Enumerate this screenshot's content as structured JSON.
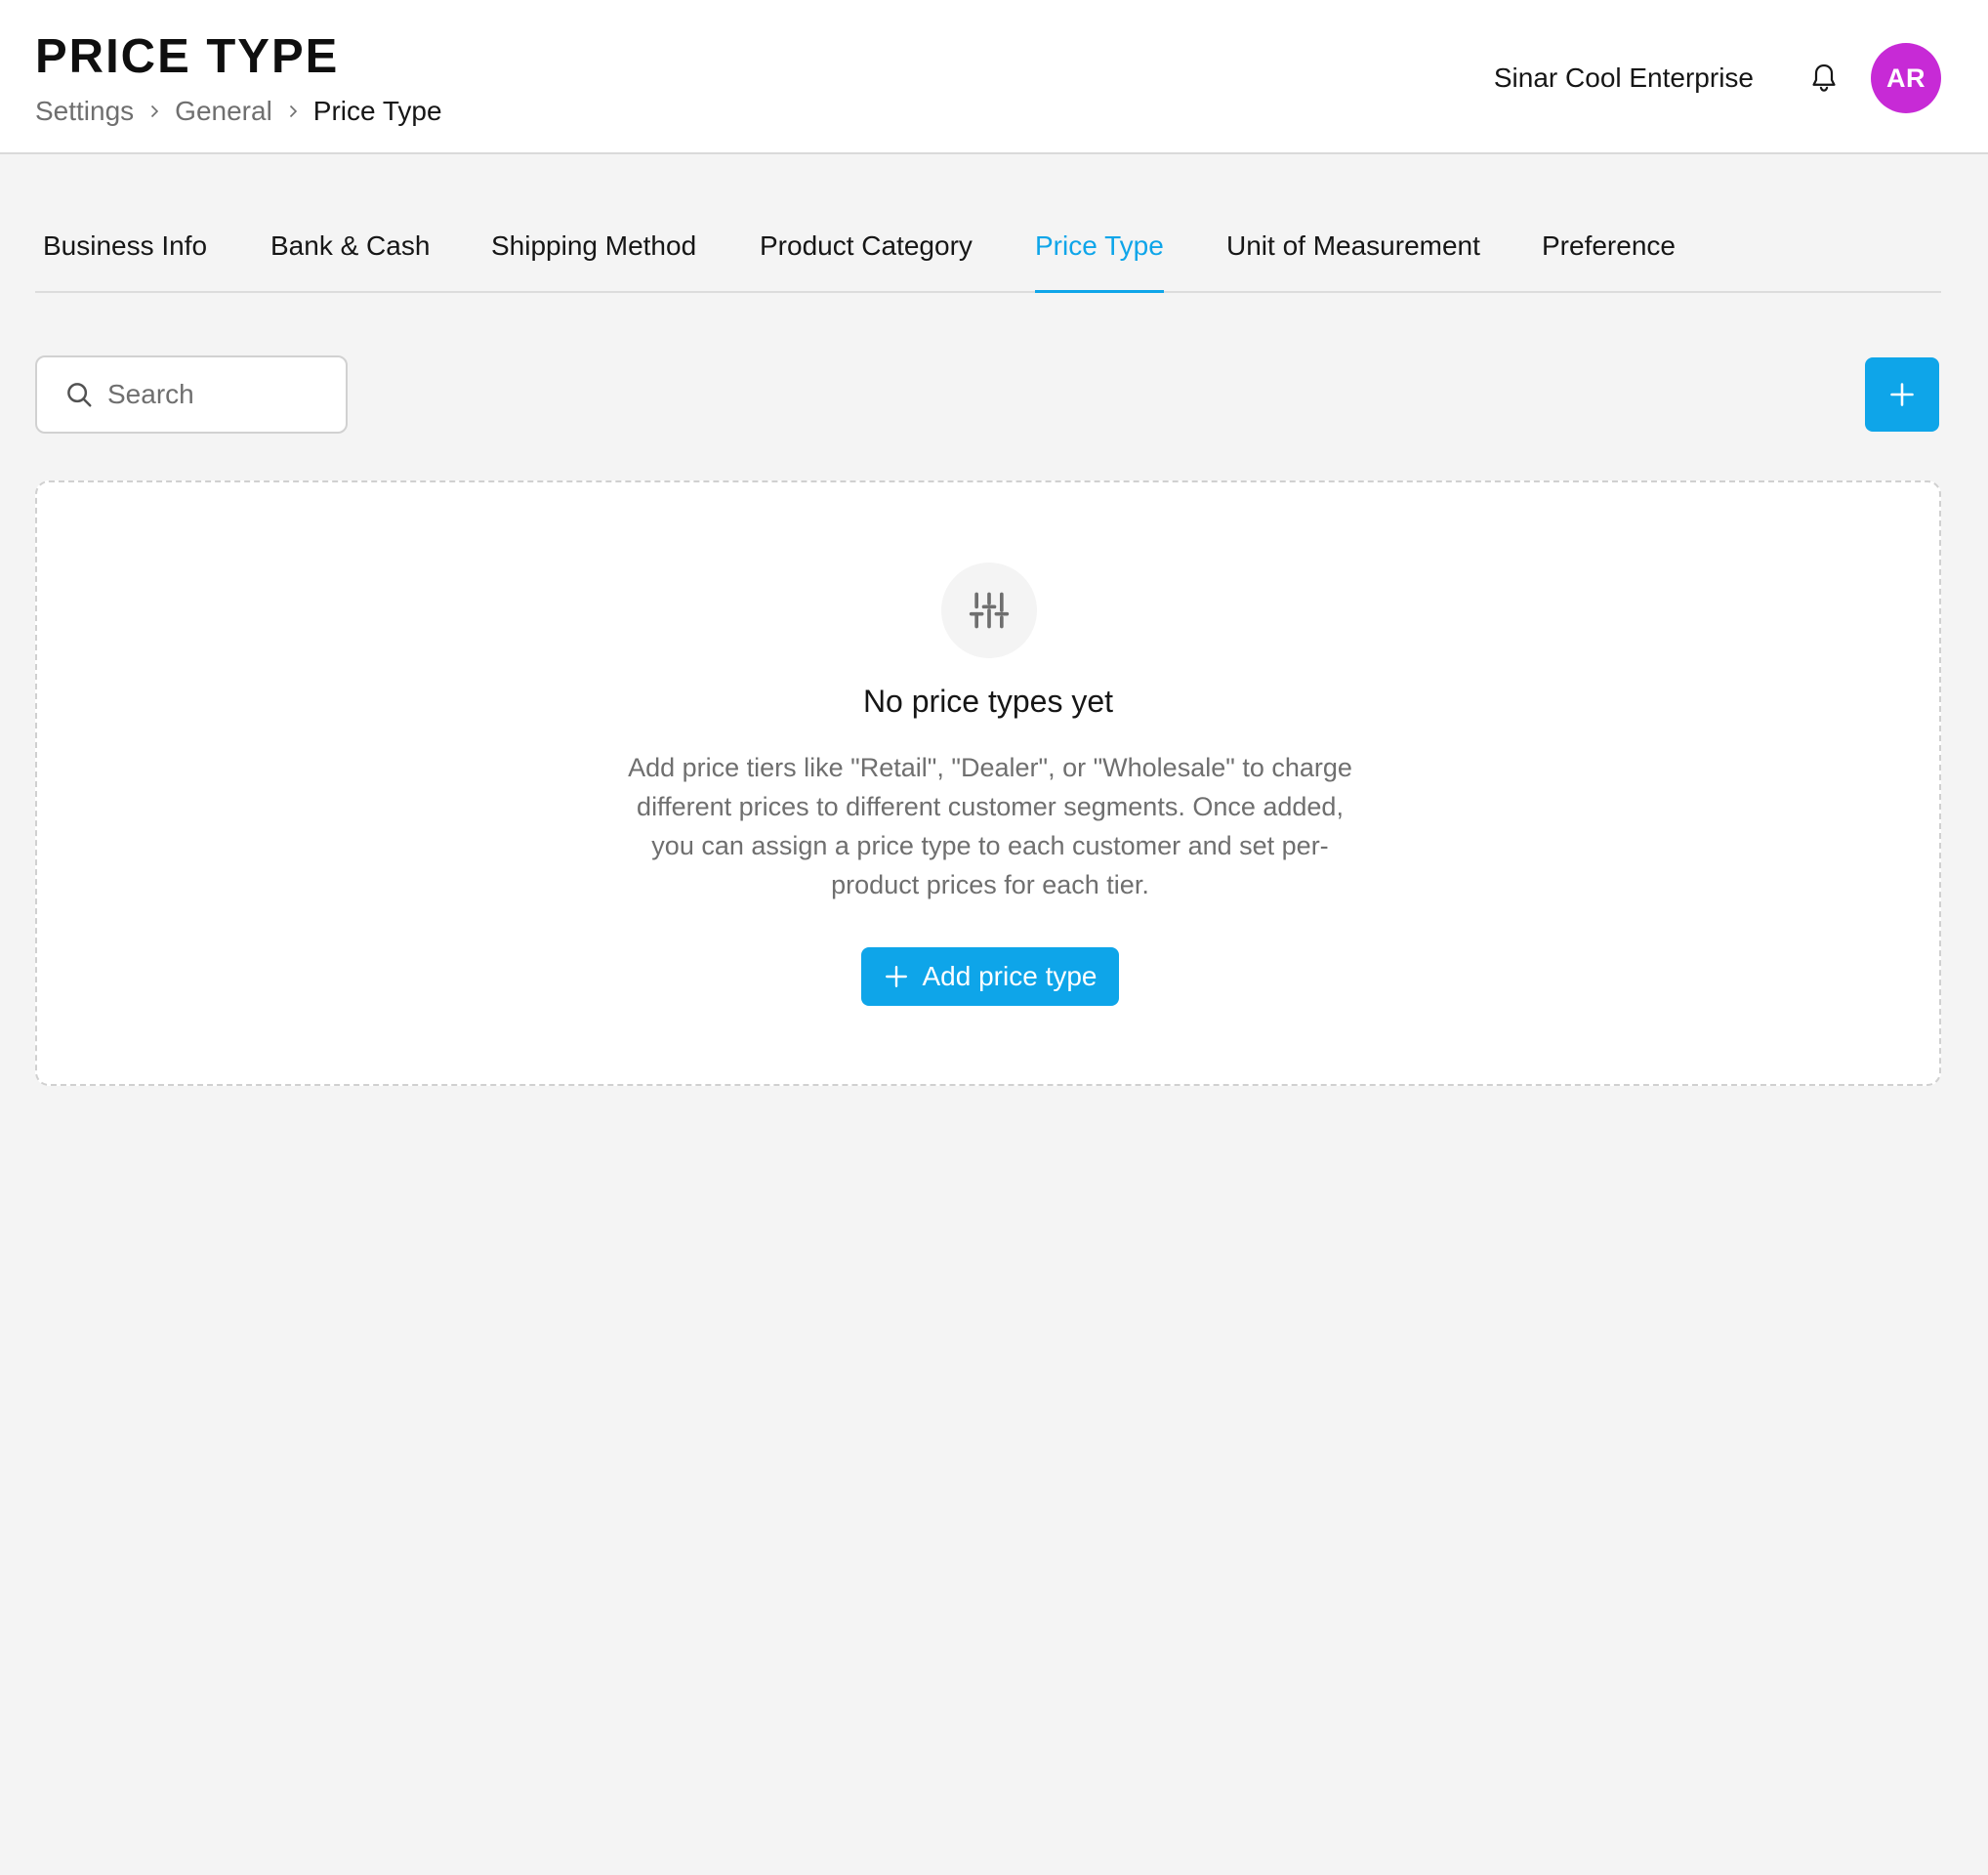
{
  "header": {
    "title": "PRICE TYPE",
    "breadcrumb": [
      "Settings",
      "General",
      "Price Type"
    ],
    "organization": "Sinar Cool Enterprise",
    "avatar_initials": "AR",
    "avatar_color": "#c72ad6"
  },
  "tabs": [
    {
      "label": "Business Info",
      "active": false
    },
    {
      "label": "Bank & Cash",
      "active": false
    },
    {
      "label": "Shipping Method",
      "active": false
    },
    {
      "label": "Product Category",
      "active": false
    },
    {
      "label": "Price Type",
      "active": true
    },
    {
      "label": "Unit of Measurement",
      "active": false
    },
    {
      "label": "Preference",
      "active": false
    }
  ],
  "toolbar": {
    "search_placeholder": "Search",
    "search_value": ""
  },
  "empty_state": {
    "icon": "sliders-icon",
    "title": "No price types yet",
    "description": "Add price tiers like \"Retail\", \"Dealer\", or \"Wholesale\" to charge different prices to different customer segments. Once added, you can assign a price type to each customer and set per-product prices for each tier.",
    "button_label": "Add price type"
  },
  "colors": {
    "accent": "#0ea5e9",
    "background": "#f4f4f4",
    "muted_text": "#6f6f6f"
  }
}
